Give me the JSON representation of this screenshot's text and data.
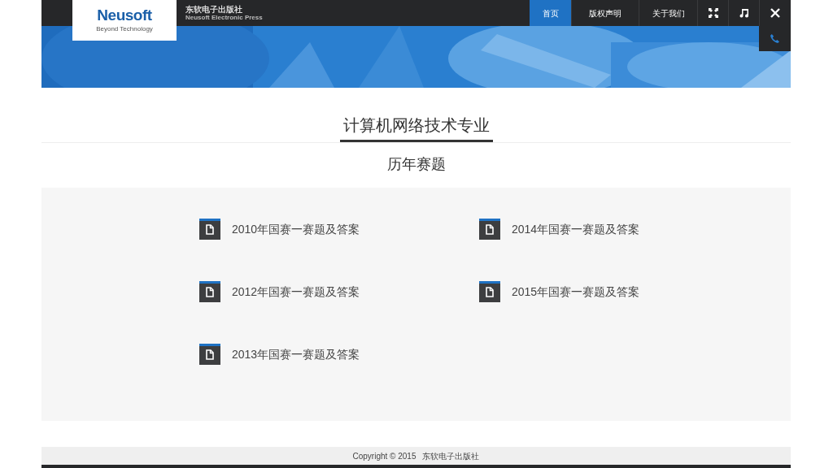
{
  "brand": {
    "logo": "Neusoft",
    "tagline": "Beyond Technology",
    "publisher": "东软电子出版社",
    "publisher_en": "Neusoft Electronic Press"
  },
  "nav": [
    {
      "label": "首页",
      "selected": true
    },
    {
      "label": "版权声明",
      "selected": false
    },
    {
      "label": "关于我们",
      "selected": false
    }
  ],
  "page_title": "计算机网络技术专业",
  "section_title": "历年赛题",
  "documents": [
    {
      "label": "2010年国赛一赛题及答案"
    },
    {
      "label": "2014年国赛一赛题及答案"
    },
    {
      "label": "2012年国赛一赛题及答案"
    },
    {
      "label": "2015年国赛一赛题及答案"
    },
    {
      "label": "2013年国赛一赛题及答案"
    }
  ],
  "footer": {
    "copyright": "Copyright © 2015",
    "publisher": "东软电子出版社"
  }
}
